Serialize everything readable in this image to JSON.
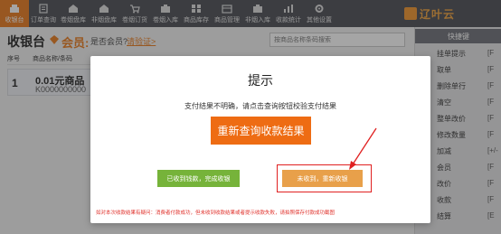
{
  "nav": {
    "items": [
      {
        "label": "收银台",
        "icon": "cash-register-icon"
      },
      {
        "label": "订单查询",
        "icon": "order-search-icon"
      },
      {
        "label": "卷烟盘库",
        "icon": "warehouse-icon"
      },
      {
        "label": "非烟盘库",
        "icon": "warehouse-icon"
      },
      {
        "label": "卷烟订货",
        "icon": "cart-icon"
      },
      {
        "label": "卷烟入库",
        "icon": "inbound-icon"
      },
      {
        "label": "商品库存",
        "icon": "inventory-icon"
      },
      {
        "label": "商品管理",
        "icon": "goods-icon"
      },
      {
        "label": "非烟入库",
        "icon": "inbound-icon"
      },
      {
        "label": "收款统计",
        "icon": "stats-icon"
      },
      {
        "label": "其他设置",
        "icon": "gear-icon"
      }
    ],
    "logo_text": "辽叶云"
  },
  "pos": {
    "title": "收银台",
    "member_label": "会员:",
    "member_question": "是否会员?",
    "member_link": "请验证>",
    "search_placeholder": "按商品名称条码搜索"
  },
  "table": {
    "headers": [
      "序号",
      "商品名称/条码"
    ],
    "rows": [
      {
        "index": "1",
        "name": "0.01元商品",
        "code": "K0000000000"
      }
    ]
  },
  "side": {
    "header": "快捷键",
    "items": [
      {
        "label": "挂单提示",
        "key": "[F"
      },
      {
        "label": "取单",
        "key": "[F"
      },
      {
        "label": "删除单行",
        "key": "[F"
      },
      {
        "label": "清空",
        "key": "[F"
      },
      {
        "label": "整单改价",
        "key": "[F"
      },
      {
        "label": "修改数量",
        "key": "[F"
      },
      {
        "label": "加减",
        "key": "[+/-"
      },
      {
        "label": "会员",
        "key": "[F"
      },
      {
        "label": "改价",
        "key": "[F"
      },
      {
        "label": "收款",
        "key": "[F"
      },
      {
        "label": "结算",
        "key": "[E"
      }
    ]
  },
  "dialog": {
    "title": "提示",
    "message": "支付结果不明确，请点击查询按钮校验支付结果",
    "query_button": "重新查询收款结果",
    "done_button": "已收到钱款，完成收银",
    "retry_button": "未收到，重新收银",
    "note": "如对本次收款结果有疑问：消费者付款成功，但未收到收款结果或者提示收款失败，请拍照保存付款成功截图"
  },
  "colors": {
    "nav_bg": "#4a4c54",
    "accent": "#e8791d",
    "query_button": "#ee6c13",
    "done_button": "#76b33a",
    "retry_button": "#e8a04a",
    "annotation": "#e02020"
  }
}
